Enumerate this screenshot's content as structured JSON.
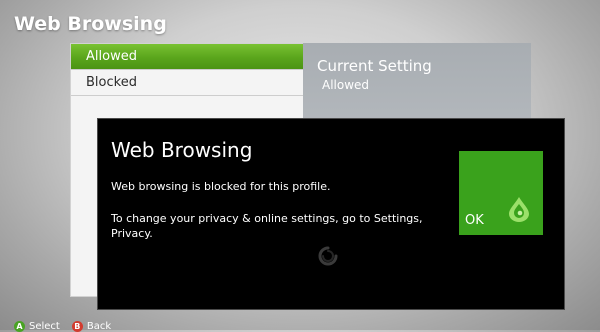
{
  "page": {
    "title": "Web Browsing"
  },
  "options": [
    {
      "label": "Allowed",
      "selected": true
    },
    {
      "label": "Blocked",
      "selected": false
    }
  ],
  "current_setting": {
    "title": "Current Setting",
    "value": "Allowed"
  },
  "dialog": {
    "title": "Web Browsing",
    "message": "Web browsing is blocked for this profile.",
    "detail": "To change your privacy & online settings, go to Settings, Privacy.",
    "ok_label": "OK",
    "ok_icon": "green-orb-icon",
    "spinner_icon": "loading-spinner-icon"
  },
  "footer": {
    "select_button": "A",
    "select_label": "Select",
    "back_button": "B",
    "back_label": "Back"
  },
  "colors": {
    "accent_green": "#5aa51c",
    "ok_tile": "#3aa21c",
    "dialog_bg": "#000000"
  }
}
